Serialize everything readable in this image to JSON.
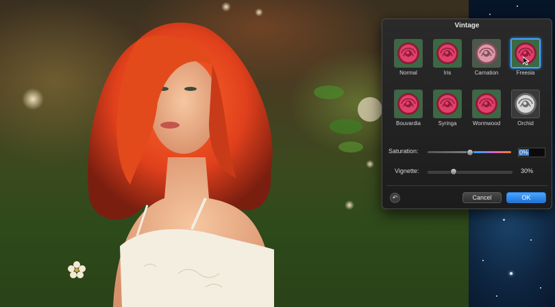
{
  "dialog": {
    "title": "Vintage",
    "presets": [
      {
        "label": "Normal",
        "style": "color",
        "selected": false
      },
      {
        "label": "Iris",
        "style": "color",
        "selected": false
      },
      {
        "label": "Carnation",
        "style": "muted",
        "selected": false
      },
      {
        "label": "Freesia",
        "style": "color",
        "selected": true
      },
      {
        "label": "Bouvardia",
        "style": "color",
        "selected": false
      },
      {
        "label": "Syringa",
        "style": "color",
        "selected": false
      },
      {
        "label": "Wormwood",
        "style": "color",
        "selected": false
      },
      {
        "label": "Orchid",
        "style": "mono",
        "selected": false
      }
    ],
    "saturation": {
      "label": "Saturation:",
      "value": "0%",
      "level": 0.5
    },
    "vignette": {
      "label": "Vignette:",
      "value": "30%",
      "level": 0.3
    },
    "cancel_label": "Cancel",
    "ok_label": "OK",
    "revert_icon": "↶"
  },
  "colors": {
    "accent": "#3fa4ff",
    "ok_button": "#1f73d6",
    "rose": "#e0406a"
  }
}
